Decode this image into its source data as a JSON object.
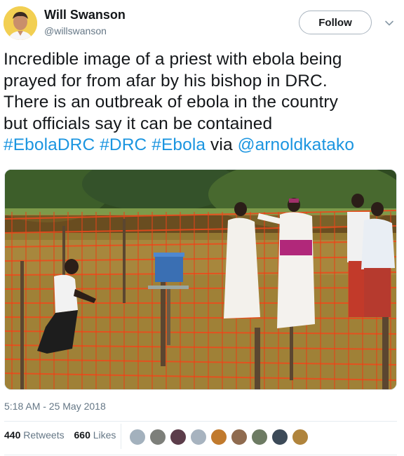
{
  "author": {
    "name": "Will Swanson",
    "handle": "@willswanson",
    "avatar_icon": "profile-photo"
  },
  "follow_label": "Follow",
  "tweet": {
    "line1": "Incredible image of a priest with ebola being",
    "line2": "prayed for from afar by his bishop in DRC.",
    "line3": "There is an outbreak of ebola in the country",
    "line4": "but officials say it can be contained",
    "tag1": "#EbolaDRC",
    "tag2": "#DRC",
    "tag3": "#Ebola",
    "via": "via",
    "mention": "@arnoldkatako"
  },
  "timestamp": "5:18 AM - 25 May 2018",
  "stats": {
    "retweets_count": "440",
    "retweets_label": "Retweets",
    "likes_count": "660",
    "likes_label": "Likes"
  },
  "colors": {
    "link": "#1b95e0",
    "secondary_text": "#657786",
    "avatar_bg": "#f2cf52"
  }
}
